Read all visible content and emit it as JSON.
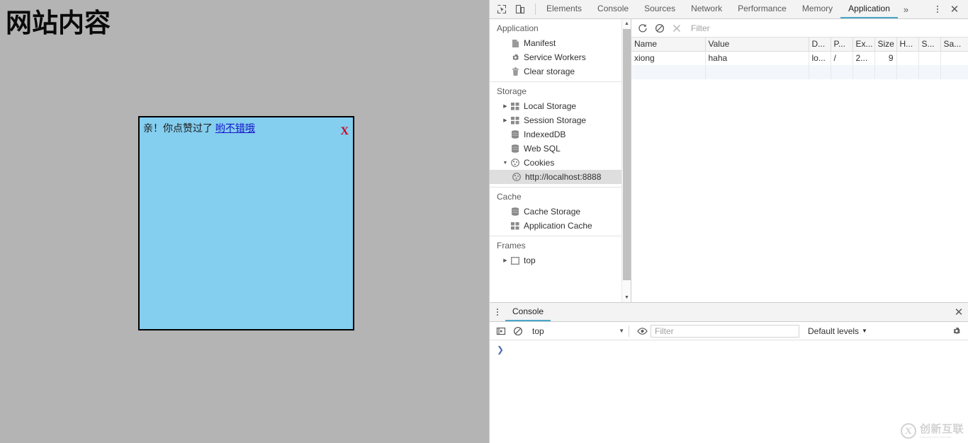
{
  "page": {
    "title": "网站内容",
    "background_color": "#b4b4b4",
    "popup": {
      "message_prefix": "亲！你点赞过了 ",
      "link_text": "哟不错哦",
      "close_label": "X",
      "background_color": "#84ceef",
      "border_color": "#000000",
      "link_color": "#1414c8",
      "close_color": "#cc0022"
    }
  },
  "devtools": {
    "accent_color": "#4ba6c9",
    "toolbar": {
      "inspect_icon": "inspect-element-icon",
      "device_icon": "device-toolbar-icon",
      "more_tabs_label": "»",
      "menu_label": "customize-menu",
      "close_label": "✕"
    },
    "tabs": [
      {
        "label": "Elements",
        "active": false
      },
      {
        "label": "Console",
        "active": false
      },
      {
        "label": "Sources",
        "active": false
      },
      {
        "label": "Network",
        "active": false
      },
      {
        "label": "Performance",
        "active": false
      },
      {
        "label": "Memory",
        "active": false
      },
      {
        "label": "Application",
        "active": true
      }
    ],
    "sidebar": {
      "sections": [
        {
          "title": "Application",
          "items": [
            {
              "label": "Manifest",
              "icon": "manifest-icon",
              "arrow": "",
              "indent": 1,
              "selected": false
            },
            {
              "label": "Service Workers",
              "icon": "gear-icon",
              "arrow": "",
              "indent": 1,
              "selected": false
            },
            {
              "label": "Clear storage",
              "icon": "trash-icon",
              "arrow": "",
              "indent": 1,
              "selected": false
            }
          ]
        },
        {
          "title": "Storage",
          "items": [
            {
              "label": "Local Storage",
              "icon": "table-icon",
              "arrow": "▶",
              "indent": 1,
              "selected": false
            },
            {
              "label": "Session Storage",
              "icon": "table-icon",
              "arrow": "▶",
              "indent": 1,
              "selected": false
            },
            {
              "label": "IndexedDB",
              "icon": "database-icon",
              "arrow": "",
              "indent": 1,
              "selected": false
            },
            {
              "label": "Web SQL",
              "icon": "database-icon",
              "arrow": "",
              "indent": 1,
              "selected": false
            },
            {
              "label": "Cookies",
              "icon": "cookie-icon",
              "arrow": "▼",
              "indent": 1,
              "selected": false
            },
            {
              "label": "http://localhost:8888",
              "icon": "cookie-icon",
              "arrow": "",
              "indent": 2,
              "selected": true
            }
          ]
        },
        {
          "title": "Cache",
          "items": [
            {
              "label": "Cache Storage",
              "icon": "database-icon",
              "arrow": "",
              "indent": 1,
              "selected": false
            },
            {
              "label": "Application Cache",
              "icon": "table-icon",
              "arrow": "",
              "indent": 1,
              "selected": false
            }
          ]
        },
        {
          "title": "Frames",
          "items": [
            {
              "label": "top",
              "icon": "frame-icon",
              "arrow": "▶",
              "indent": 1,
              "selected": false
            }
          ]
        }
      ]
    },
    "cookies_panel": {
      "refresh_icon": "refresh-icon",
      "clear_icon": "clear-all-icon",
      "delete_icon": "delete-selected-icon",
      "filter_placeholder": "Filter",
      "columns": [
        "Name",
        "Value",
        "D...",
        "P...",
        "Ex...",
        "Size",
        "H...",
        "S...",
        "Sa..."
      ],
      "rows": [
        [
          "xiong",
          "haha",
          "lo...",
          "/",
          "2...",
          "9",
          "",
          "",
          ""
        ]
      ]
    },
    "drawer": {
      "menu_label": "drawer-menu",
      "tab_label": "Console",
      "close_label": "✕",
      "execute_icon": "execute-snippet-icon",
      "clear_icon": "clear-console-icon",
      "context_value": "top",
      "eye_icon": "live-expression-icon",
      "filter_placeholder": "Filter",
      "levels_label": "Default levels",
      "gear_icon": "console-settings-icon",
      "prompt_symbol": "❯"
    }
  },
  "watermark": {
    "mark": "X",
    "chinese": "创新互联",
    "pinyin": "CHUANGXIN HULIAN"
  }
}
